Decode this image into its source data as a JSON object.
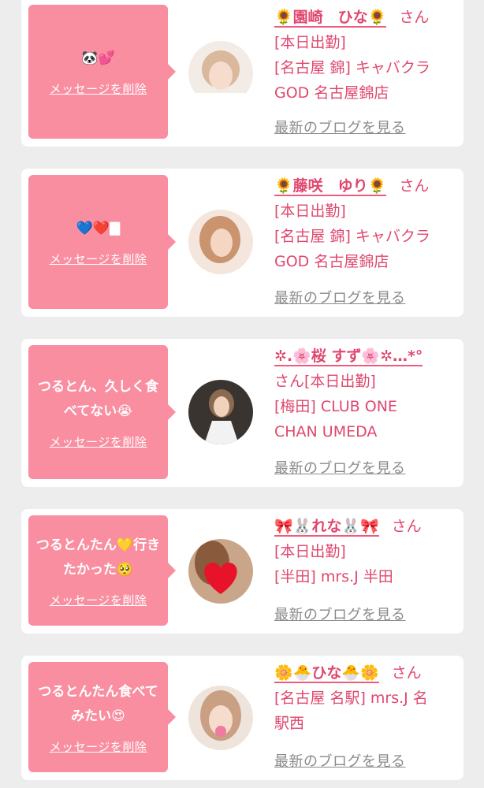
{
  "delete_label": "メッセージを削除",
  "blog_label": "最新のブログを見る",
  "cards": [
    {
      "message": "🐼💕",
      "name": "🌻園崎　ひな🌻",
      "san": "さん",
      "details": [
        "[本日出勤]",
        "[名古屋 錦] キャバクラ",
        "GOD 名古屋錦店"
      ]
    },
    {
      "message": "💙❤️🀫",
      "name": "🌻藤咲　ゆり🌻",
      "san": "さん",
      "details": [
        "[本日出勤]",
        "[名古屋 錦] キャバクラ",
        "GOD 名古屋錦店"
      ]
    },
    {
      "message": "つるとん、久しく食べてない😭",
      "name": "✲.🌸桜 すず🌸✲…*°",
      "san": "さん[本日出勤]",
      "details": [
        "[梅田] CLUB ONE",
        "CHAN UMEDA"
      ]
    },
    {
      "message": "つるとんたん💛行きたかった🥺",
      "name": "🎀🐰れな🐰🎀",
      "san": "さん",
      "details": [
        "[本日出勤]",
        "[半田] mrs.J 半田"
      ]
    },
    {
      "message": "つるとんたん食べてみたい😍",
      "name": "🌼🐣ひな🐣🌼",
      "san": "さん",
      "details": [
        "[名古屋 名駅] mrs.J 名",
        "駅西"
      ]
    }
  ]
}
